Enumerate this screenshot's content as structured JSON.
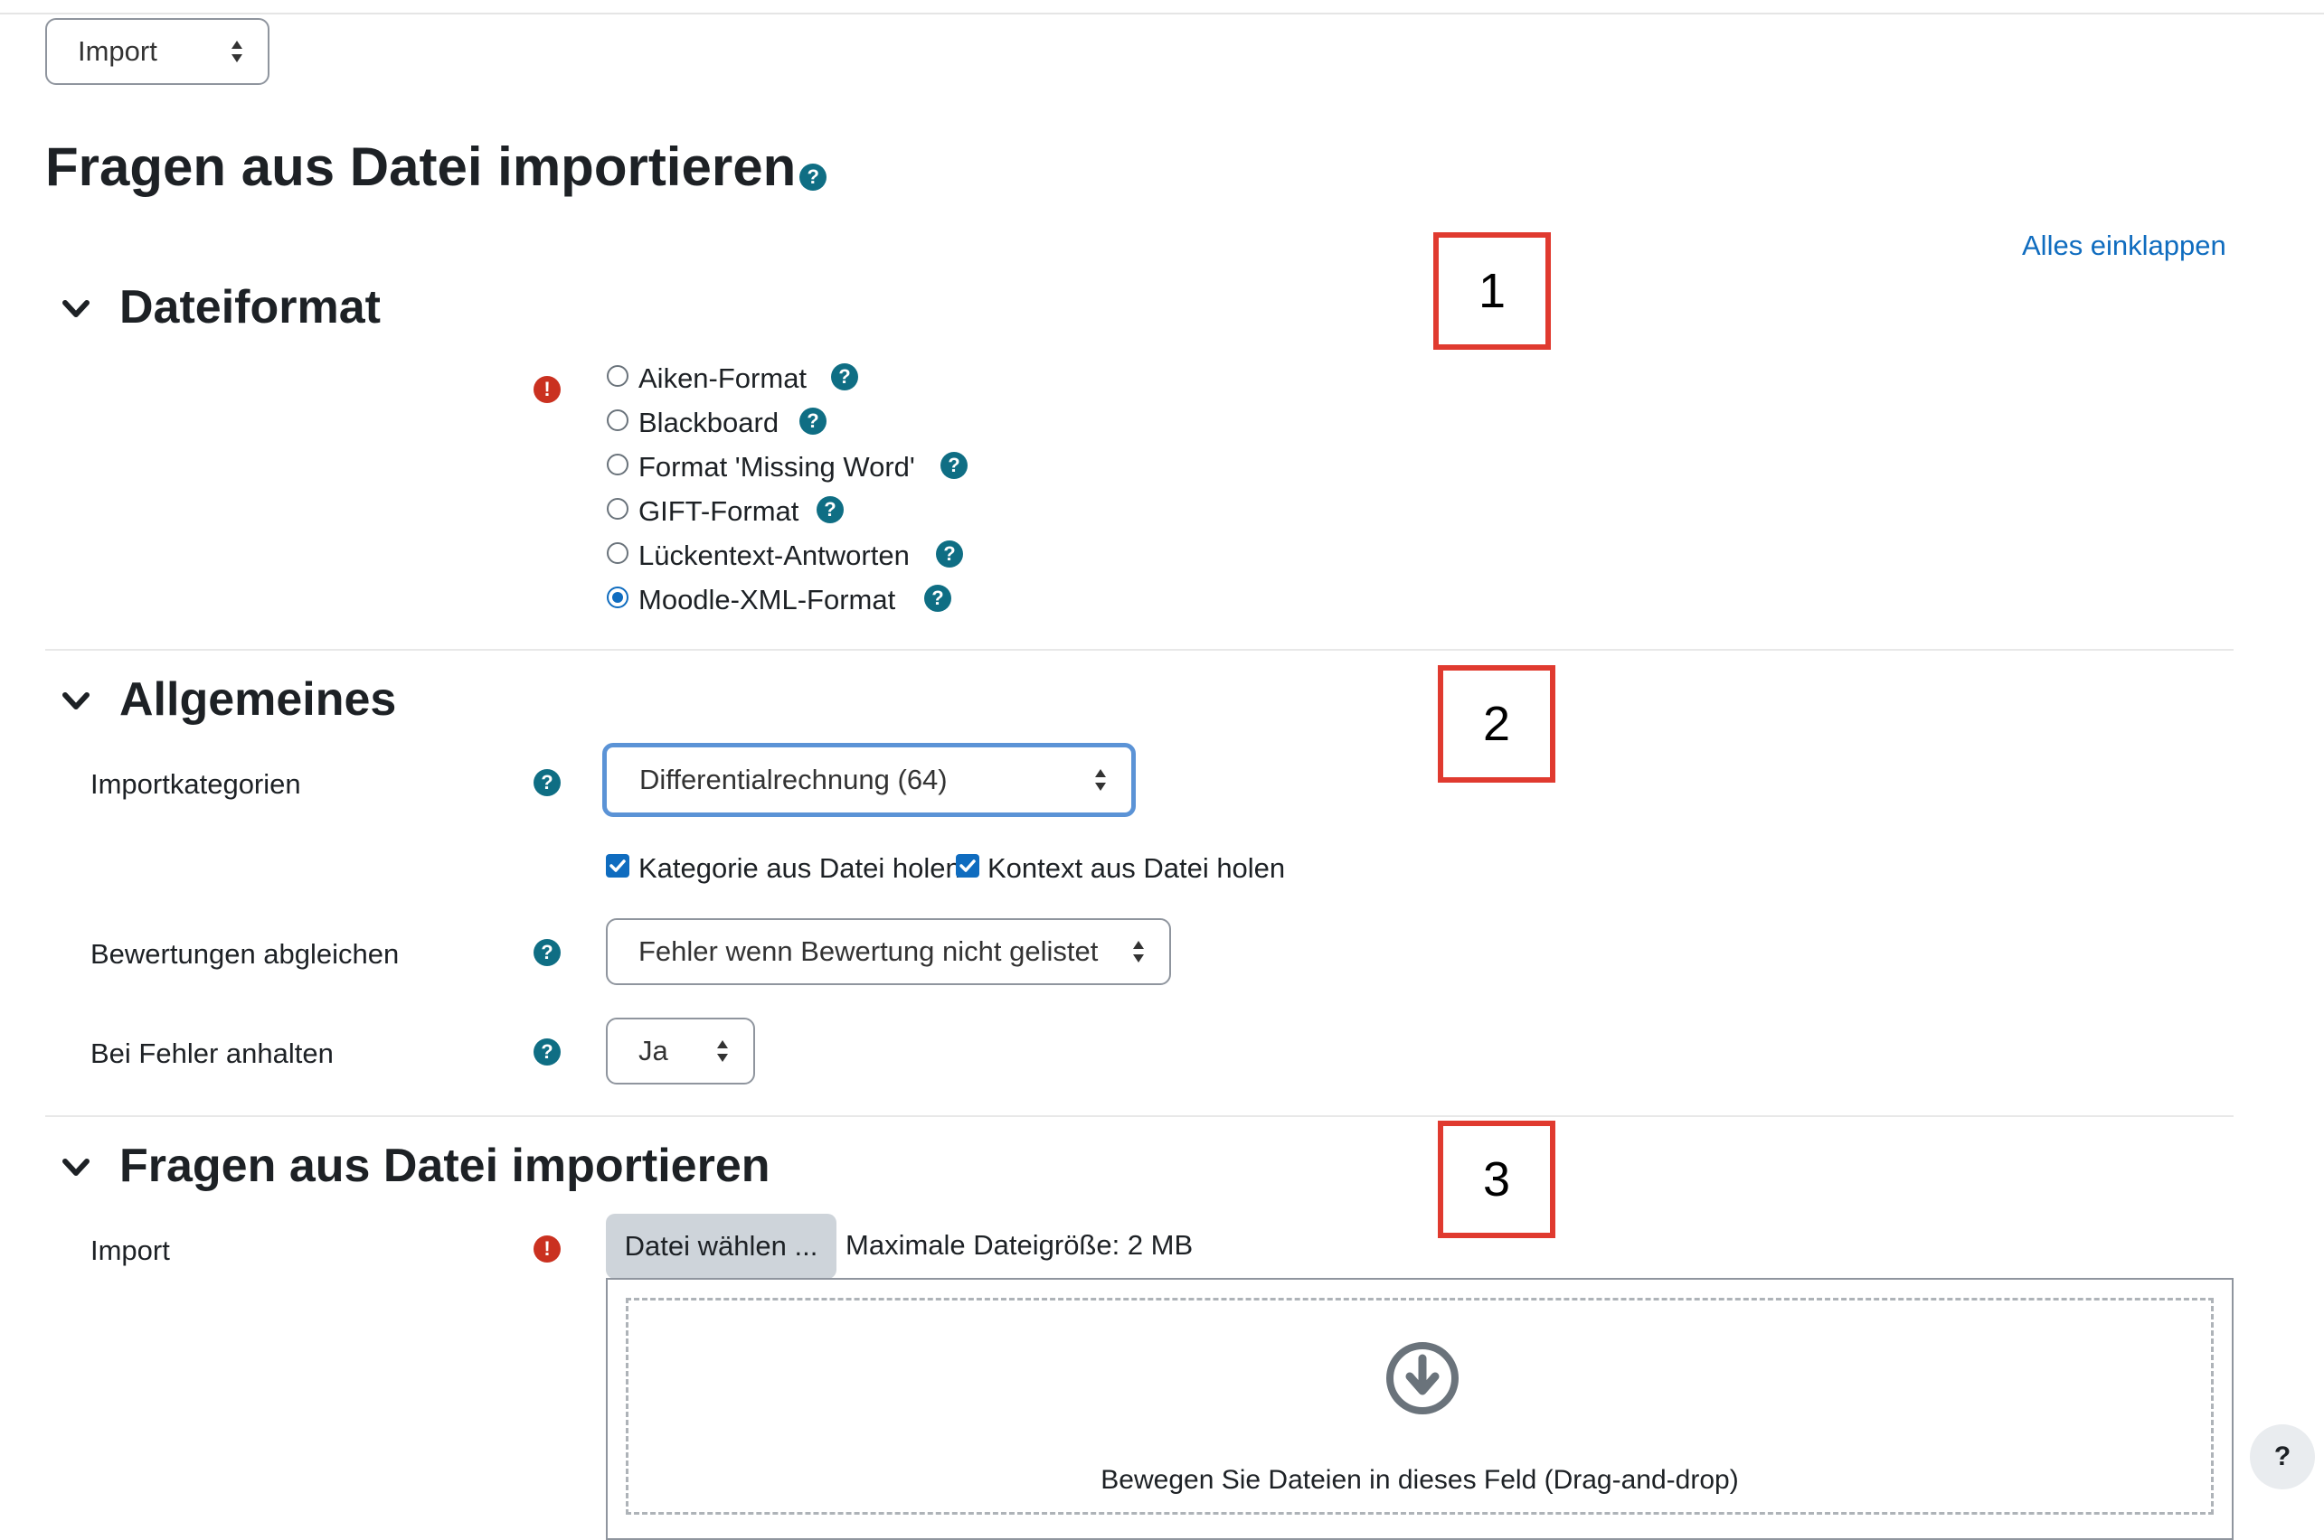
{
  "top_select": {
    "value": "Import"
  },
  "page_title": "Fragen aus Datei importieren",
  "collapse_all_link": "Alles einklappen",
  "markers": [
    "1",
    "2",
    "3"
  ],
  "sections": {
    "dateiformat": {
      "title": "Dateiformat",
      "options": [
        {
          "label": "Aiken-Format",
          "selected": false
        },
        {
          "label": "Blackboard",
          "selected": false
        },
        {
          "label": "Format 'Missing Word'",
          "selected": false
        },
        {
          "label": "GIFT-Format",
          "selected": false
        },
        {
          "label": "Lückentext-Antworten",
          "selected": false
        },
        {
          "label": "Moodle-XML-Format",
          "selected": true
        }
      ]
    },
    "allgemeines": {
      "title": "Allgemeines",
      "importkategorien_label": "Importkategorien",
      "importkategorien_value": "Differentialrechnung (64)",
      "checkbox_category": "Kategorie aus Datei holen",
      "checkbox_context": "Kontext aus Datei holen",
      "bewertungen_label": "Bewertungen abgleichen",
      "bewertungen_value": "Fehler wenn Bewertung nicht gelistet",
      "fehler_label": "Bei Fehler anhalten",
      "fehler_value": "Ja"
    },
    "import": {
      "title": "Fragen aus Datei importieren",
      "import_label": "Import",
      "file_button": "Datei wählen ...",
      "max_size": "Maximale Dateigröße: 2 MB",
      "dropzone_text": "Bewegen Sie Dateien in dieses Feld (Drag-and-drop)"
    }
  },
  "floating_help": "?",
  "colors": {
    "accent": "#0f6cbf",
    "help": "#0f6e84",
    "required": "#ca3120",
    "marker": "#e03a2f"
  },
  "icons": [
    "chevron-down-icon",
    "help-icon",
    "required-icon",
    "download-arrow-icon",
    "sort-arrows-icon"
  ]
}
